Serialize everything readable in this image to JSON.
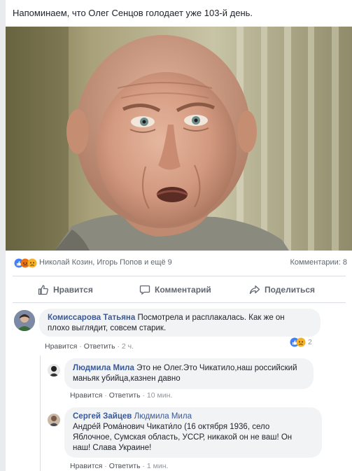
{
  "post": {
    "text": "Напоминаем, что Олег Сенцов голодает уже 103-й день."
  },
  "reactions": {
    "names": "Николай Козин, Игорь Попов и ещё 9",
    "comments": "Комментарии: 8"
  },
  "actions": {
    "like": "Нравится",
    "comment": "Комментарий",
    "share": "Поделиться"
  },
  "comments": [
    {
      "author": "Комиссарова Татьяна",
      "text": "Посмотрела и расплакалась. Как же он",
      "text2": "плохо выглядит, совсем старик.",
      "like": "Нравится",
      "reply": "Ответить",
      "time": "2 ч.",
      "reaction_count": "2"
    }
  ],
  "replies": [
    {
      "author": "Людмила Мила",
      "text": "Это не Олег.Это Чикатило,наш российский",
      "text2": "маньяк убийца,казнен давно",
      "like": "Нравится",
      "reply": "Ответить",
      "time": "10 мин."
    },
    {
      "author": "Сергей Зайцев",
      "mention": "Людмила Мила",
      "line1": "Андре́й Рома́нович Чикати́ло (16 октября 1936, село",
      "line2": "Яблочное, Сумская область, УССР, никакой он не ваш! Он",
      "line3": "наш! Слава Украине!",
      "like": "Нравится",
      "reply": "Ответить",
      "time": "1 мин."
    }
  ],
  "dot": "·",
  "colors": {
    "link": "#385898",
    "meta": "#90949c",
    "bubble": "#f2f3f5",
    "like_blue": "#4080ff",
    "angry": "#e9710f",
    "sad": "#f7b125"
  }
}
